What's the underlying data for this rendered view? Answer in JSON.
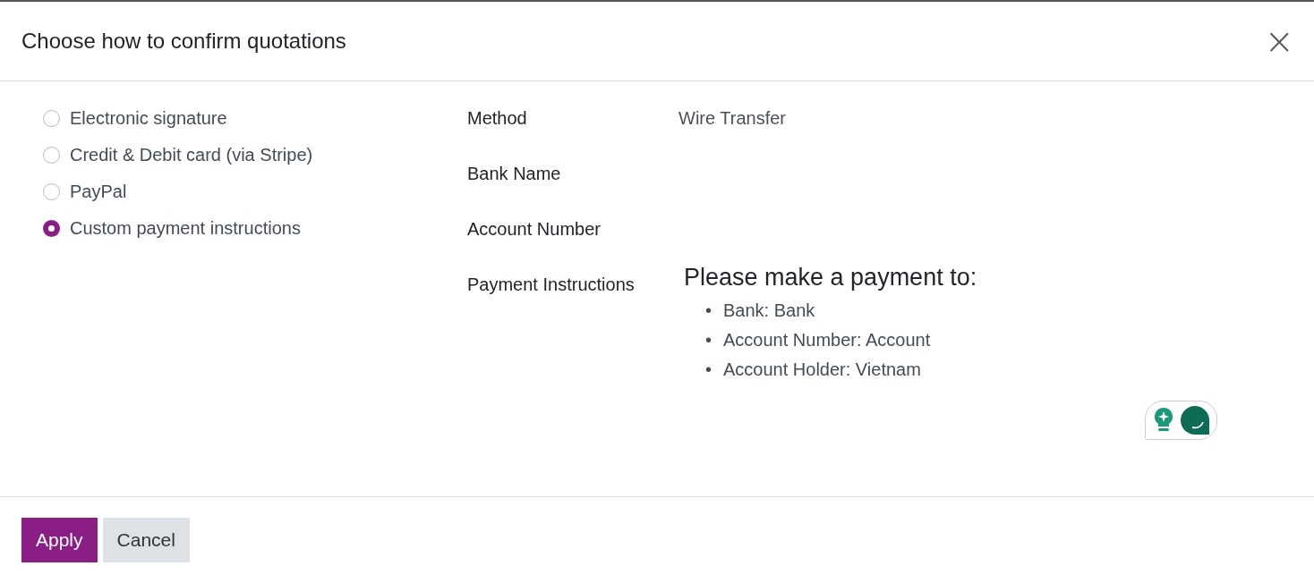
{
  "dialog": {
    "title": "Choose how to confirm quotations",
    "close": "×"
  },
  "options": [
    {
      "label": "Electronic signature",
      "selected": false
    },
    {
      "label": "Credit & Debit card (via Stripe)",
      "selected": false
    },
    {
      "label": "PayPal",
      "selected": false
    },
    {
      "label": "Custom payment instructions",
      "selected": true
    }
  ],
  "fields": [
    {
      "kind": "text",
      "label": "Method",
      "value": "Wire Transfer"
    },
    {
      "kind": "empty",
      "label": "Bank Name"
    },
    {
      "kind": "empty",
      "label": "Account Number"
    },
    {
      "kind": "rich",
      "label": "Payment Instructions",
      "heading": "Please make a payment to:",
      "bullets": [
        {
          "marker": "•",
          "text": "Bank: Bank"
        },
        {
          "marker": "•",
          "text": "Account Number: Account"
        },
        {
          "marker": "•",
          "text": "Account Holder: Vietnam"
        }
      ]
    }
  ],
  "buttons": [
    {
      "label": "Apply",
      "kind": "primary"
    },
    {
      "label": "Cancel",
      "kind": "secondary"
    }
  ]
}
